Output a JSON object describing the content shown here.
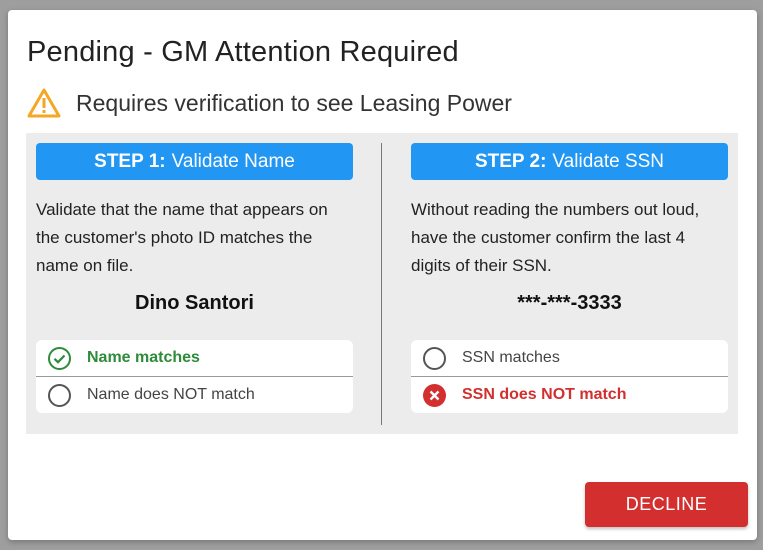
{
  "dialog": {
    "title": "Pending - GM Attention Required",
    "warning_icon": "warning-triangle-icon",
    "warning_text": "Requires verification to see Leasing Power",
    "accent_color": "#2196f3",
    "warning_color": "#f5a623"
  },
  "step1": {
    "label": "STEP 1:",
    "title": "Validate Name",
    "description": "Validate that the name that appears on the customer's photo ID matches the name on file.",
    "value": "Dino Santori",
    "options": [
      {
        "label": "Name matches",
        "selected": true,
        "icon": "check-circle-icon",
        "color": "#2e8b3a"
      },
      {
        "label": "Name does NOT match",
        "selected": false,
        "icon": "radio-unchecked-icon"
      }
    ]
  },
  "step2": {
    "label": "STEP 2:",
    "title": "Validate SSN",
    "description": "Without reading the numbers out loud, have the customer confirm the last 4 digits of their SSN.",
    "value": "***-***-3333",
    "options": [
      {
        "label": "SSN matches",
        "selected": false,
        "icon": "radio-unchecked-icon"
      },
      {
        "label": "SSN does NOT match",
        "selected": true,
        "icon": "x-circle-icon",
        "color": "#d32f2f"
      }
    ]
  },
  "actions": {
    "decline_label": "DECLINE",
    "decline_color": "#d32f2f"
  }
}
